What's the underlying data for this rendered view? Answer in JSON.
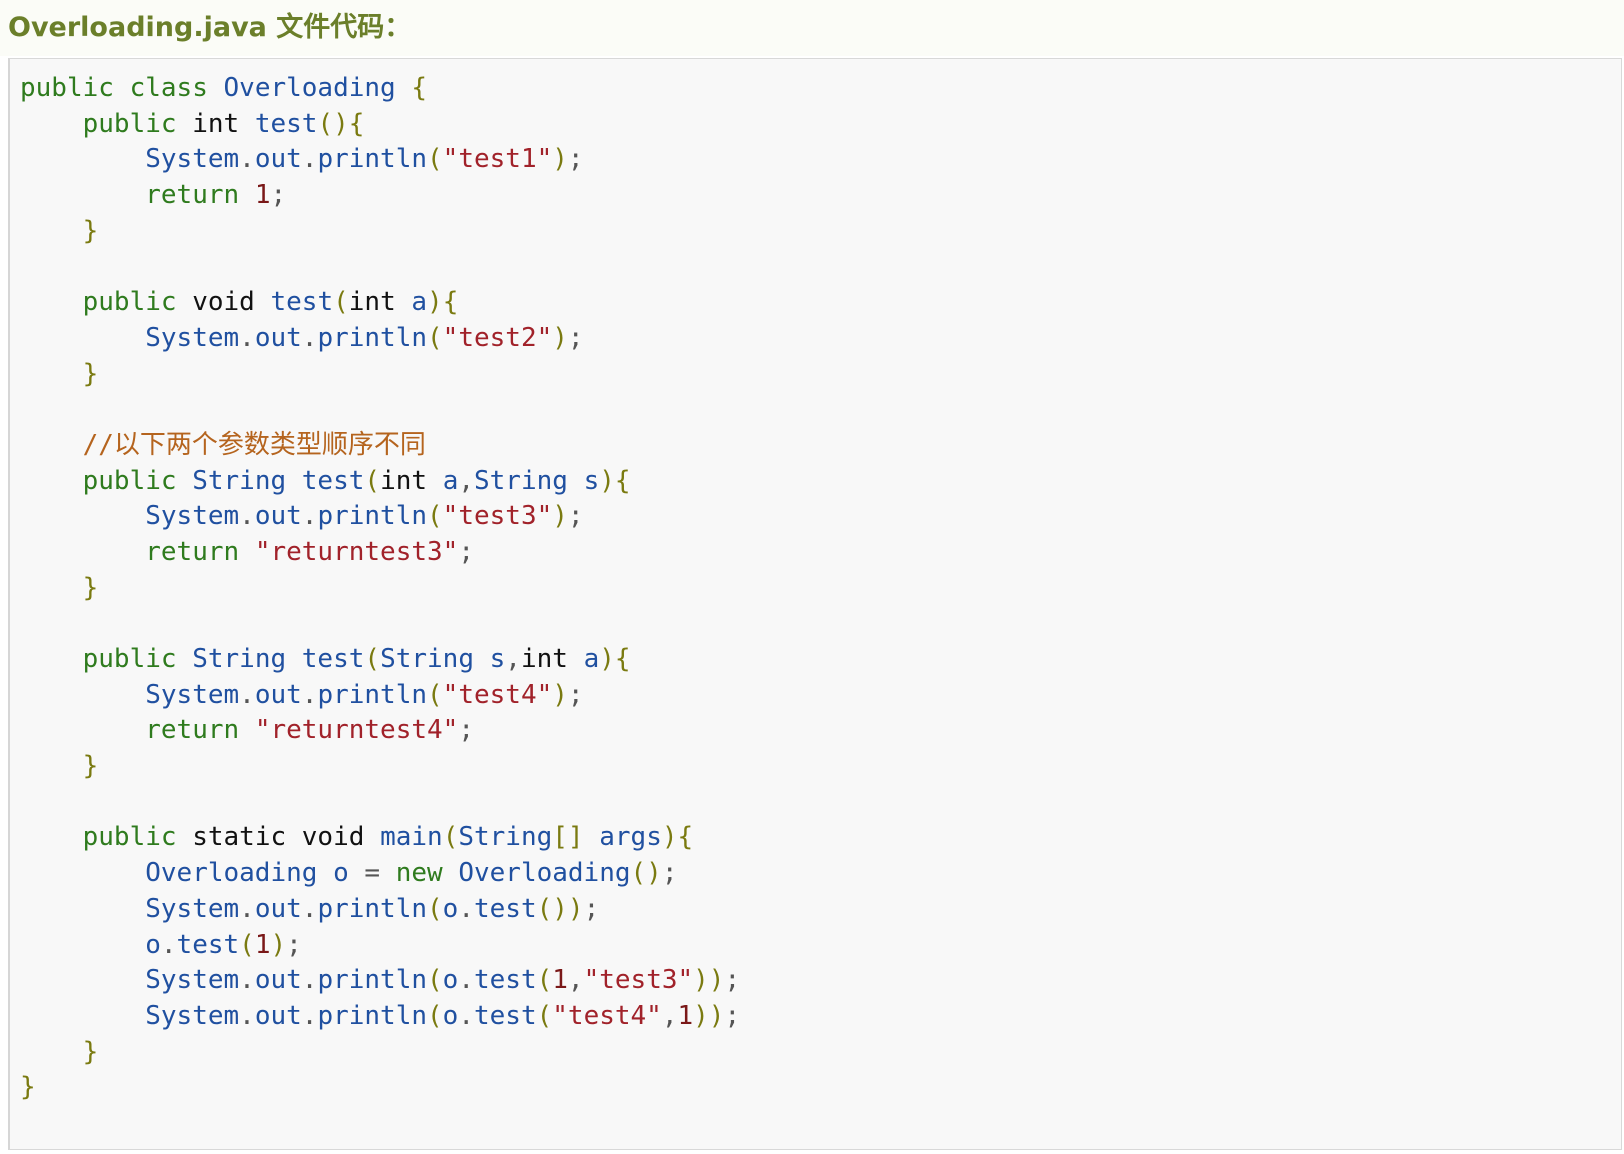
{
  "header": {
    "title": "Overloading.java 文件代码："
  },
  "code": {
    "lines": [
      [
        {
          "c": "kw",
          "t": "public"
        },
        {
          "c": "op",
          "t": " "
        },
        {
          "c": "kw",
          "t": "class"
        },
        {
          "c": "op",
          "t": " "
        },
        {
          "c": "id",
          "t": "Overloading"
        },
        {
          "c": "op",
          "t": " "
        },
        {
          "c": "pn",
          "t": "{"
        }
      ],
      [
        {
          "c": "op",
          "t": "    "
        },
        {
          "c": "kw",
          "t": "public"
        },
        {
          "c": "op",
          "t": " "
        },
        {
          "c": "tp",
          "t": "int"
        },
        {
          "c": "op",
          "t": " "
        },
        {
          "c": "id",
          "t": "test"
        },
        {
          "c": "pn",
          "t": "(){"
        }
      ],
      [
        {
          "c": "op",
          "t": "        "
        },
        {
          "c": "id",
          "t": "System"
        },
        {
          "c": "op",
          "t": "."
        },
        {
          "c": "id",
          "t": "out"
        },
        {
          "c": "op",
          "t": "."
        },
        {
          "c": "id",
          "t": "println"
        },
        {
          "c": "pn",
          "t": "("
        },
        {
          "c": "str",
          "t": "\"test1\""
        },
        {
          "c": "pn",
          "t": ")"
        },
        {
          "c": "op",
          "t": ";"
        }
      ],
      [
        {
          "c": "op",
          "t": "        "
        },
        {
          "c": "kw",
          "t": "return"
        },
        {
          "c": "op",
          "t": " "
        },
        {
          "c": "num",
          "t": "1"
        },
        {
          "c": "op",
          "t": ";"
        }
      ],
      [
        {
          "c": "op",
          "t": "    "
        },
        {
          "c": "pn",
          "t": "}"
        }
      ],
      [],
      [
        {
          "c": "op",
          "t": "    "
        },
        {
          "c": "kw",
          "t": "public"
        },
        {
          "c": "op",
          "t": " "
        },
        {
          "c": "tp",
          "t": "void"
        },
        {
          "c": "op",
          "t": " "
        },
        {
          "c": "id",
          "t": "test"
        },
        {
          "c": "pn",
          "t": "("
        },
        {
          "c": "tp",
          "t": "int"
        },
        {
          "c": "op",
          "t": " "
        },
        {
          "c": "id",
          "t": "a"
        },
        {
          "c": "pn",
          "t": "){"
        }
      ],
      [
        {
          "c": "op",
          "t": "        "
        },
        {
          "c": "id",
          "t": "System"
        },
        {
          "c": "op",
          "t": "."
        },
        {
          "c": "id",
          "t": "out"
        },
        {
          "c": "op",
          "t": "."
        },
        {
          "c": "id",
          "t": "println"
        },
        {
          "c": "pn",
          "t": "("
        },
        {
          "c": "str",
          "t": "\"test2\""
        },
        {
          "c": "pn",
          "t": ")"
        },
        {
          "c": "op",
          "t": ";"
        }
      ],
      [
        {
          "c": "op",
          "t": "    "
        },
        {
          "c": "pn",
          "t": "}"
        }
      ],
      [],
      [
        {
          "c": "op",
          "t": "    "
        },
        {
          "c": "cm",
          "t": "//以下两个参数类型顺序不同"
        }
      ],
      [
        {
          "c": "op",
          "t": "    "
        },
        {
          "c": "kw",
          "t": "public"
        },
        {
          "c": "op",
          "t": " "
        },
        {
          "c": "id",
          "t": "String"
        },
        {
          "c": "op",
          "t": " "
        },
        {
          "c": "id",
          "t": "test"
        },
        {
          "c": "pn",
          "t": "("
        },
        {
          "c": "tp",
          "t": "int"
        },
        {
          "c": "op",
          "t": " "
        },
        {
          "c": "id",
          "t": "a"
        },
        {
          "c": "op",
          "t": ","
        },
        {
          "c": "id",
          "t": "String"
        },
        {
          "c": "op",
          "t": " "
        },
        {
          "c": "id",
          "t": "s"
        },
        {
          "c": "pn",
          "t": "){"
        }
      ],
      [
        {
          "c": "op",
          "t": "        "
        },
        {
          "c": "id",
          "t": "System"
        },
        {
          "c": "op",
          "t": "."
        },
        {
          "c": "id",
          "t": "out"
        },
        {
          "c": "op",
          "t": "."
        },
        {
          "c": "id",
          "t": "println"
        },
        {
          "c": "pn",
          "t": "("
        },
        {
          "c": "str",
          "t": "\"test3\""
        },
        {
          "c": "pn",
          "t": ")"
        },
        {
          "c": "op",
          "t": ";"
        }
      ],
      [
        {
          "c": "op",
          "t": "        "
        },
        {
          "c": "kw",
          "t": "return"
        },
        {
          "c": "op",
          "t": " "
        },
        {
          "c": "str",
          "t": "\"returntest3\""
        },
        {
          "c": "op",
          "t": ";"
        }
      ],
      [
        {
          "c": "op",
          "t": "    "
        },
        {
          "c": "pn",
          "t": "}"
        }
      ],
      [],
      [
        {
          "c": "op",
          "t": "    "
        },
        {
          "c": "kw",
          "t": "public"
        },
        {
          "c": "op",
          "t": " "
        },
        {
          "c": "id",
          "t": "String"
        },
        {
          "c": "op",
          "t": " "
        },
        {
          "c": "id",
          "t": "test"
        },
        {
          "c": "pn",
          "t": "("
        },
        {
          "c": "id",
          "t": "String"
        },
        {
          "c": "op",
          "t": " "
        },
        {
          "c": "id",
          "t": "s"
        },
        {
          "c": "op",
          "t": ","
        },
        {
          "c": "tp",
          "t": "int"
        },
        {
          "c": "op",
          "t": " "
        },
        {
          "c": "id",
          "t": "a"
        },
        {
          "c": "pn",
          "t": "){"
        }
      ],
      [
        {
          "c": "op",
          "t": "        "
        },
        {
          "c": "id",
          "t": "System"
        },
        {
          "c": "op",
          "t": "."
        },
        {
          "c": "id",
          "t": "out"
        },
        {
          "c": "op",
          "t": "."
        },
        {
          "c": "id",
          "t": "println"
        },
        {
          "c": "pn",
          "t": "("
        },
        {
          "c": "str",
          "t": "\"test4\""
        },
        {
          "c": "pn",
          "t": ")"
        },
        {
          "c": "op",
          "t": ";"
        }
      ],
      [
        {
          "c": "op",
          "t": "        "
        },
        {
          "c": "kw",
          "t": "return"
        },
        {
          "c": "op",
          "t": " "
        },
        {
          "c": "str",
          "t": "\"returntest4\""
        },
        {
          "c": "op",
          "t": ";"
        }
      ],
      [
        {
          "c": "op",
          "t": "    "
        },
        {
          "c": "pn",
          "t": "}"
        }
      ],
      [],
      [
        {
          "c": "op",
          "t": "    "
        },
        {
          "c": "kw",
          "t": "public"
        },
        {
          "c": "op",
          "t": " "
        },
        {
          "c": "tp",
          "t": "static"
        },
        {
          "c": "op",
          "t": " "
        },
        {
          "c": "tp",
          "t": "void"
        },
        {
          "c": "op",
          "t": " "
        },
        {
          "c": "id",
          "t": "main"
        },
        {
          "c": "pn",
          "t": "("
        },
        {
          "c": "id",
          "t": "String"
        },
        {
          "c": "pn",
          "t": "[]"
        },
        {
          "c": "op",
          "t": " "
        },
        {
          "c": "id",
          "t": "args"
        },
        {
          "c": "pn",
          "t": "){"
        }
      ],
      [
        {
          "c": "op",
          "t": "        "
        },
        {
          "c": "id",
          "t": "Overloading"
        },
        {
          "c": "op",
          "t": " "
        },
        {
          "c": "id",
          "t": "o"
        },
        {
          "c": "op",
          "t": " = "
        },
        {
          "c": "kw",
          "t": "new"
        },
        {
          "c": "op",
          "t": " "
        },
        {
          "c": "id",
          "t": "Overloading"
        },
        {
          "c": "pn",
          "t": "()"
        },
        {
          "c": "op",
          "t": ";"
        }
      ],
      [
        {
          "c": "op",
          "t": "        "
        },
        {
          "c": "id",
          "t": "System"
        },
        {
          "c": "op",
          "t": "."
        },
        {
          "c": "id",
          "t": "out"
        },
        {
          "c": "op",
          "t": "."
        },
        {
          "c": "id",
          "t": "println"
        },
        {
          "c": "pn",
          "t": "("
        },
        {
          "c": "id",
          "t": "o"
        },
        {
          "c": "op",
          "t": "."
        },
        {
          "c": "id",
          "t": "test"
        },
        {
          "c": "pn",
          "t": "())"
        },
        {
          "c": "op",
          "t": ";"
        }
      ],
      [
        {
          "c": "op",
          "t": "        "
        },
        {
          "c": "id",
          "t": "o"
        },
        {
          "c": "op",
          "t": "."
        },
        {
          "c": "id",
          "t": "test"
        },
        {
          "c": "pn",
          "t": "("
        },
        {
          "c": "num",
          "t": "1"
        },
        {
          "c": "pn",
          "t": ")"
        },
        {
          "c": "op",
          "t": ";"
        }
      ],
      [
        {
          "c": "op",
          "t": "        "
        },
        {
          "c": "id",
          "t": "System"
        },
        {
          "c": "op",
          "t": "."
        },
        {
          "c": "id",
          "t": "out"
        },
        {
          "c": "op",
          "t": "."
        },
        {
          "c": "id",
          "t": "println"
        },
        {
          "c": "pn",
          "t": "("
        },
        {
          "c": "id",
          "t": "o"
        },
        {
          "c": "op",
          "t": "."
        },
        {
          "c": "id",
          "t": "test"
        },
        {
          "c": "pn",
          "t": "("
        },
        {
          "c": "num",
          "t": "1"
        },
        {
          "c": "op",
          "t": ","
        },
        {
          "c": "str",
          "t": "\"test3\""
        },
        {
          "c": "pn",
          "t": "))"
        },
        {
          "c": "op",
          "t": ";"
        }
      ],
      [
        {
          "c": "op",
          "t": "        "
        },
        {
          "c": "id",
          "t": "System"
        },
        {
          "c": "op",
          "t": "."
        },
        {
          "c": "id",
          "t": "out"
        },
        {
          "c": "op",
          "t": "."
        },
        {
          "c": "id",
          "t": "println"
        },
        {
          "c": "pn",
          "t": "("
        },
        {
          "c": "id",
          "t": "o"
        },
        {
          "c": "op",
          "t": "."
        },
        {
          "c": "id",
          "t": "test"
        },
        {
          "c": "pn",
          "t": "("
        },
        {
          "c": "str",
          "t": "\"test4\""
        },
        {
          "c": "op",
          "t": ","
        },
        {
          "c": "num",
          "t": "1"
        },
        {
          "c": "pn",
          "t": "))"
        },
        {
          "c": "op",
          "t": ";"
        }
      ],
      [
        {
          "c": "op",
          "t": "    "
        },
        {
          "c": "pn",
          "t": "}"
        }
      ],
      [
        {
          "c": "pn",
          "t": "}"
        }
      ]
    ]
  }
}
